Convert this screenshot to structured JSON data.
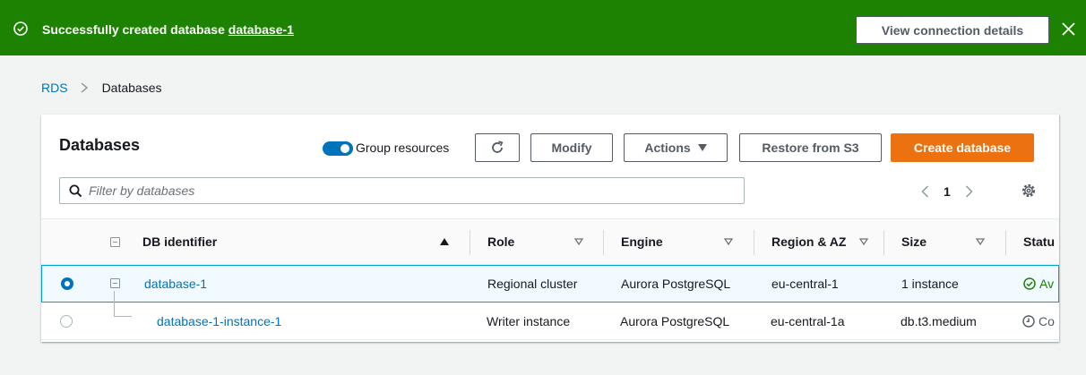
{
  "banner": {
    "message_prefix": "Successfully created database",
    "message_link": "database-1",
    "button_label": "View connection details",
    "color": "#1d8102"
  },
  "breadcrumb": {
    "root": "RDS",
    "current": "Databases"
  },
  "panel": {
    "title": "Databases",
    "toggle_label": "Group resources",
    "toggle_on": true,
    "buttons": {
      "modify": "Modify",
      "actions": "Actions",
      "restore": "Restore from S3",
      "create": "Create database"
    },
    "search_placeholder": "Filter by databases",
    "page_number": "1"
  },
  "table": {
    "columns": [
      "DB identifier",
      "Role",
      "Engine",
      "Region & AZ",
      "Size",
      "Statu"
    ],
    "rows": [
      {
        "selected": true,
        "identifier": "database-1",
        "role": "Regional cluster",
        "engine": "Aurora PostgreSQL",
        "region": "eu-central-1",
        "size": "1 instance",
        "status": "Av",
        "status_icon": "check-circle-icon"
      },
      {
        "selected": false,
        "identifier": "database-1-instance-1",
        "role": "Writer instance",
        "engine": "Aurora PostgreSQL",
        "region": "eu-central-1a",
        "size": "db.t3.medium",
        "status": "Co",
        "status_icon": "clock-icon"
      }
    ]
  },
  "colors": {
    "accent": "#0073bb",
    "primary_button": "#ec7211",
    "success": "#1d8102"
  }
}
